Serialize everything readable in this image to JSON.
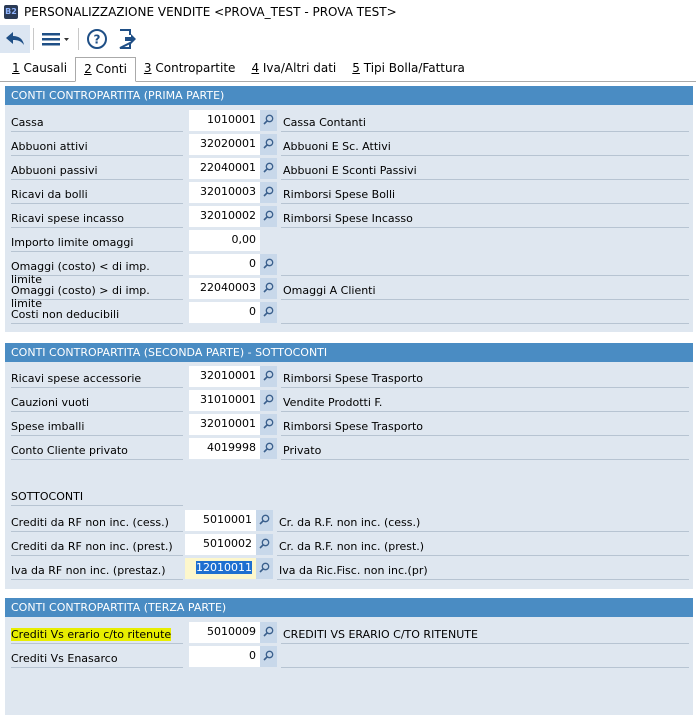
{
  "window": {
    "title": "PERSONALIZZAZIONE VENDITE <PROVA_TEST - PROVA TEST>",
    "app_icon": "B2"
  },
  "toolbar": {
    "icons": [
      "back-icon",
      "menu-icon",
      "help-icon",
      "exit-icon"
    ]
  },
  "tabs": [
    {
      "key": "1",
      "label": " Causali"
    },
    {
      "key": "2",
      "label": " Conti"
    },
    {
      "key": "3",
      "label": " Contropartite"
    },
    {
      "key": "4",
      "label": " Iva/Altri dati"
    },
    {
      "key": "5",
      "label": " Tipi Bolla/Fattura"
    }
  ],
  "selected_tab": 1,
  "sections": [
    {
      "title": "CONTI CONTROPARTITA (PRIMA PARTE)",
      "rows": [
        {
          "label": "Cassa",
          "value": "1010001",
          "desc": "Cassa Contanti",
          "lookup": true
        },
        {
          "label": "Abbuoni attivi",
          "value": "32020001",
          "desc": "Abbuoni E Sc. Attivi",
          "lookup": true
        },
        {
          "label": "Abbuoni passivi",
          "value": "22040001",
          "desc": "Abbuoni E Sconti  Passivi",
          "lookup": true
        },
        {
          "label": "Ricavi da bolli",
          "value": "32010003",
          "desc": "Rimborsi Spese Bolli",
          "lookup": true
        },
        {
          "label": "Ricavi spese incasso",
          "value": "32010002",
          "desc": "Rimborsi Spese Incasso",
          "lookup": true
        },
        {
          "label": "Importo limite omaggi",
          "value": "0,00",
          "desc": null,
          "lookup": false
        },
        {
          "label": "Omaggi (costo) < di imp. limite",
          "value": "0",
          "desc": "",
          "lookup": true
        },
        {
          "label": "Omaggi (costo) > di imp. limite",
          "value": "22040003",
          "desc": "Omaggi A Clienti",
          "lookup": true
        },
        {
          "label": "Costi non deducibili",
          "value": "0",
          "desc": "",
          "lookup": true
        }
      ]
    },
    {
      "title": "CONTI CONTROPARTITA (SECONDA PARTE) - SOTTOCONTI",
      "rows": [
        {
          "label": "Ricavi spese accessorie",
          "value": "32010001",
          "desc": "Rimborsi Spese Trasporto",
          "lookup": true
        },
        {
          "label": "Cauzioni vuoti",
          "value": "31010001",
          "desc": "Vendite Prodotti F.",
          "lookup": true
        },
        {
          "label": "Spese imballi",
          "value": "32010001",
          "desc": "Rimborsi Spese Trasporto",
          "lookup": true
        },
        {
          "label": "Conto Cliente privato",
          "value": "4019998",
          "desc": "Privato",
          "lookup": true
        }
      ],
      "subtitle": "SOTTOCONTI",
      "subrows": [
        {
          "label": "Crediti da RF non inc. (cess.)",
          "value": "5010001",
          "desc": "Cr. da R.F. non inc. (cess.)",
          "lookup": true
        },
        {
          "label": "Crediti da RF non inc. (prest.)",
          "value": "5010002",
          "desc": "Cr. da R.F. non inc. (prest.)",
          "lookup": true
        },
        {
          "label": "Iva da RF non inc. (prestaz.)",
          "value": "12010011",
          "desc": "Iva da Ric.Fisc. non inc.(pr)",
          "lookup": true,
          "focused": true
        }
      ]
    },
    {
      "title": "CONTI CONTROPARTITA (TERZA PARTE)",
      "rows": [
        {
          "label": "Crediti Vs erario c/to ritenute",
          "value": "5010009",
          "desc": "CREDITI VS ERARIO C/TO RITENUTE",
          "lookup": true,
          "highlighted": true
        },
        {
          "label": "Crediti Vs Enasarco",
          "value": "0",
          "desc": "",
          "lookup": true
        }
      ]
    }
  ]
}
